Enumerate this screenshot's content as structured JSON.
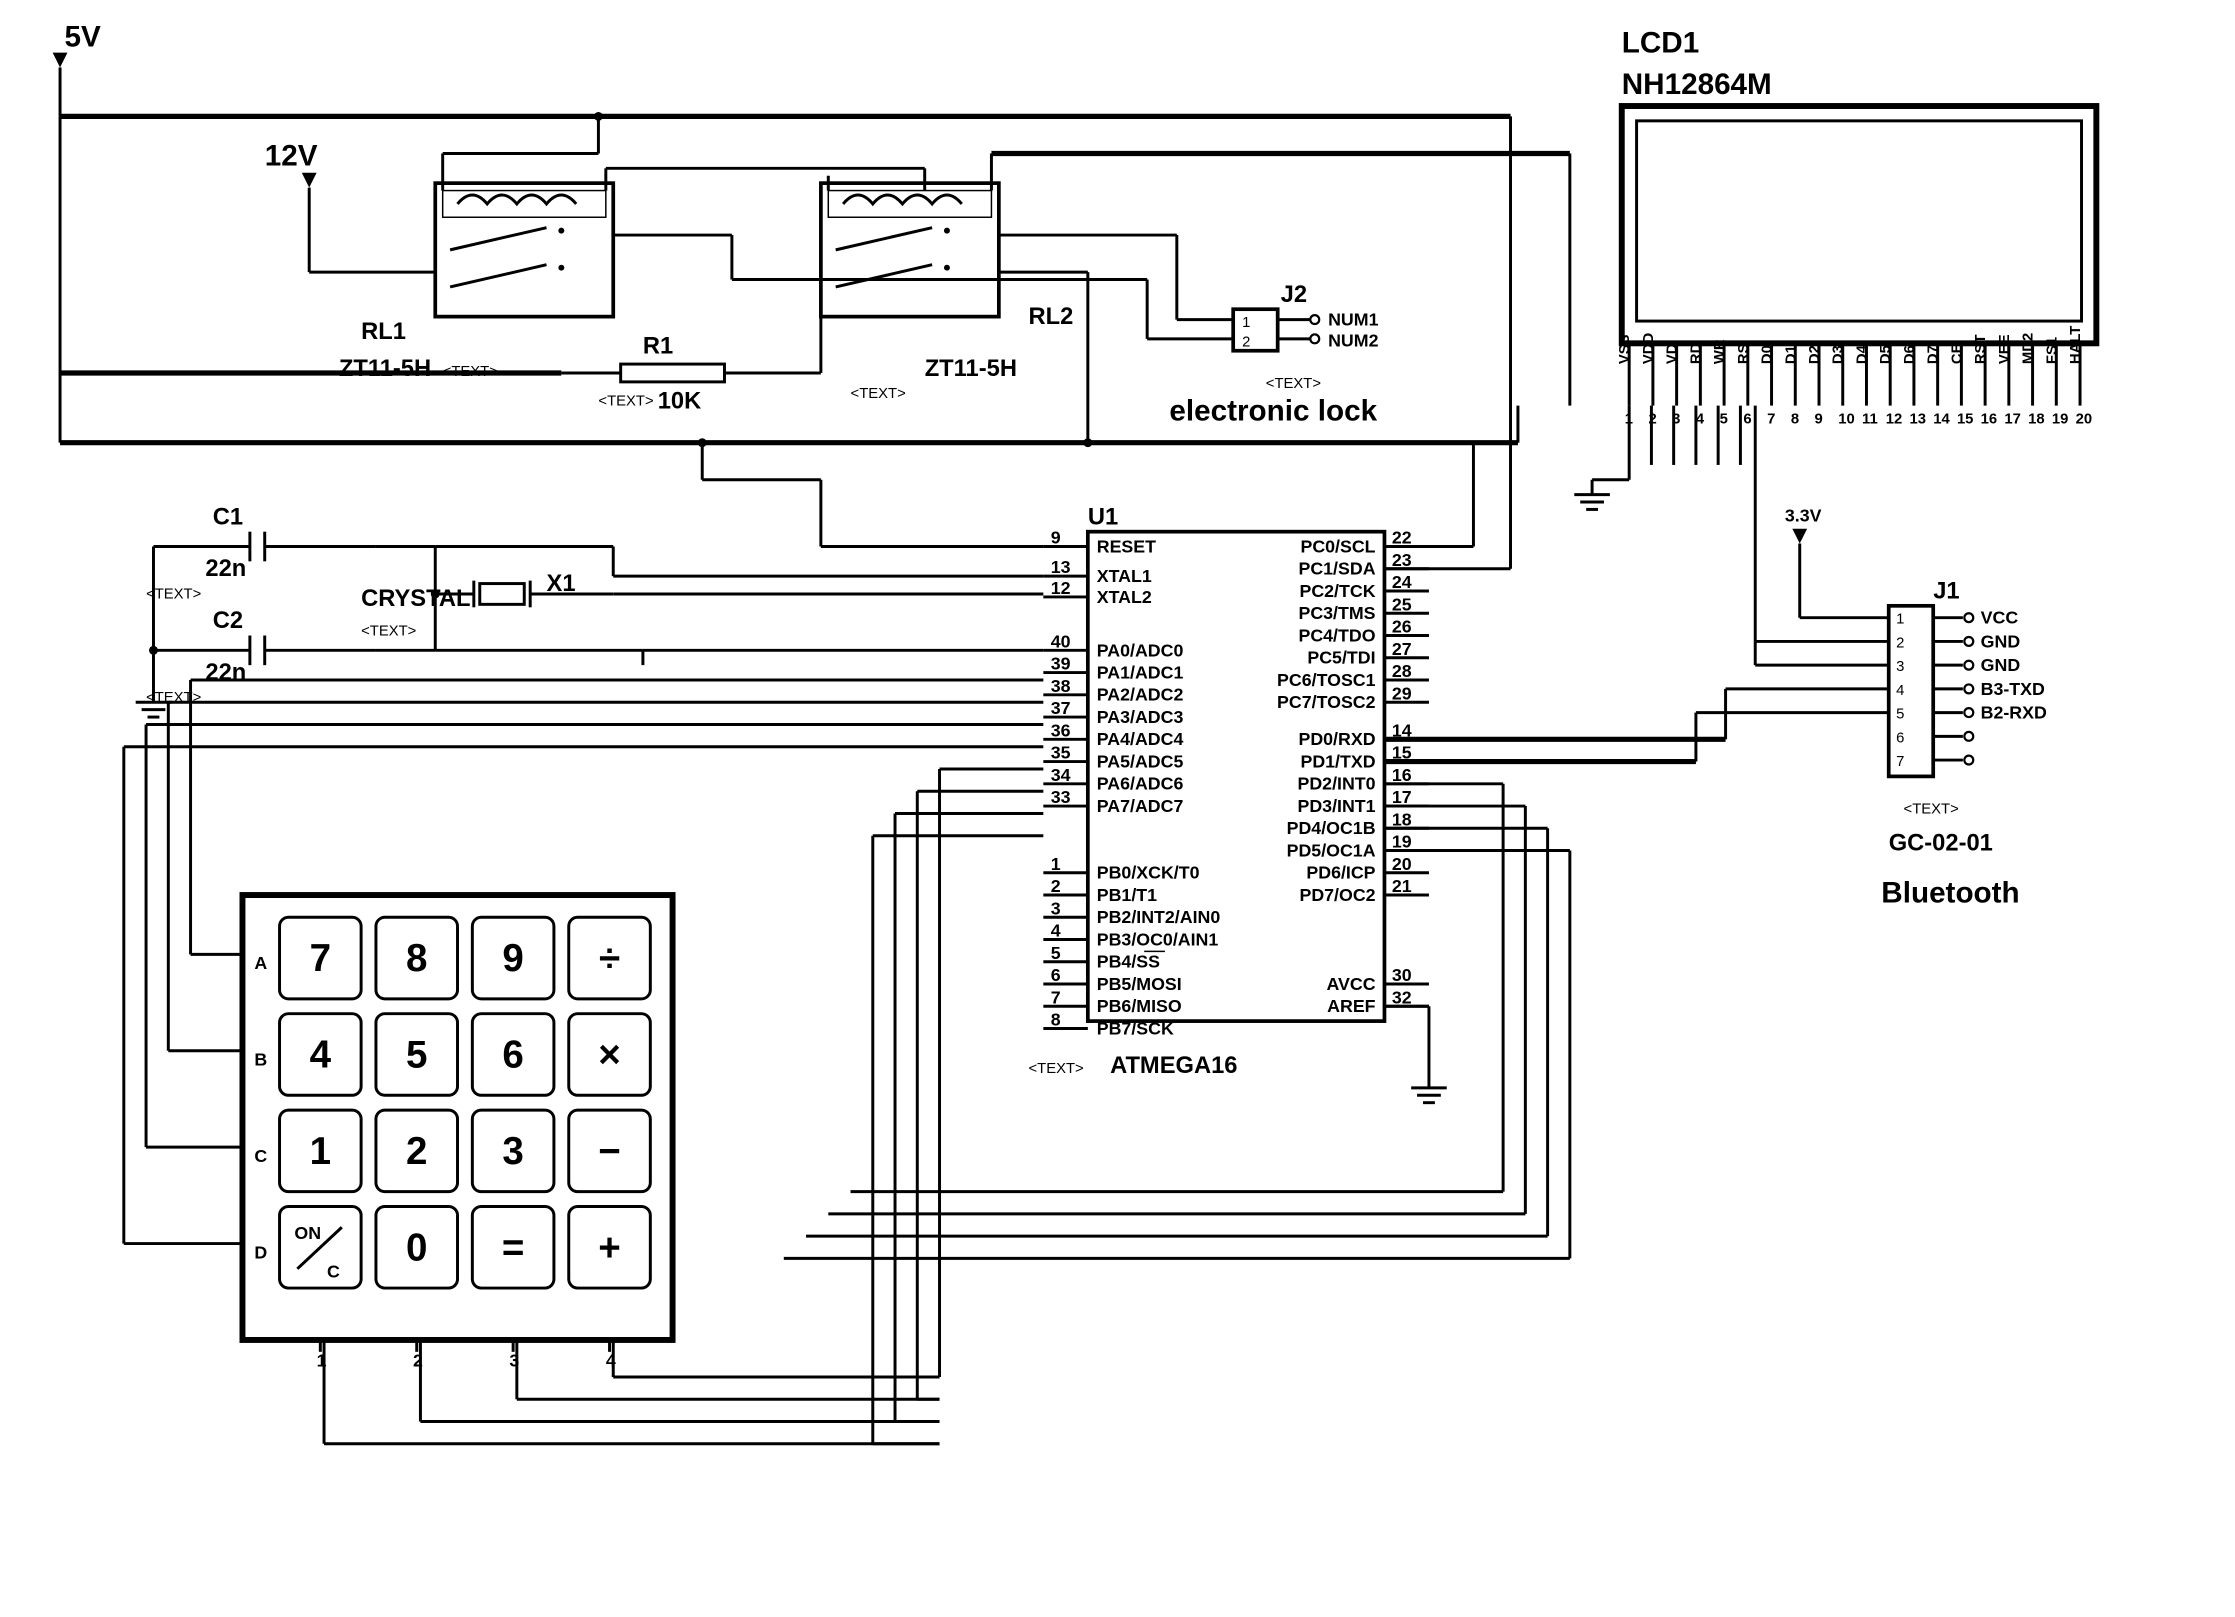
{
  "power": {
    "v5": "5V",
    "v12": "12V",
    "v33": "3.3V"
  },
  "relay1": {
    "name": "RL1",
    "model": "ZT11-5H"
  },
  "relay2": {
    "name": "RL2",
    "model": "ZT11-5H"
  },
  "resistor1": {
    "name": "R1",
    "value": "10K",
    "placeholder": "<TEXT>"
  },
  "cap1": {
    "name": "C1",
    "value": "22n",
    "placeholder": "<TEXT>"
  },
  "cap2": {
    "name": "C2",
    "value": "22n",
    "placeholder": "<TEXT>"
  },
  "crystal": {
    "name": "X1",
    "label": "CRYSTAL",
    "placeholder": "<TEXT>"
  },
  "lcd": {
    "refdes": "LCD1",
    "model": "NH12864M",
    "pins": [
      "VSS",
      "VDD",
      "VD",
      "RD",
      "WR",
      "RS",
      "D0",
      "D1",
      "D2",
      "D3",
      "D4",
      "D5",
      "D6",
      "D7",
      "CE",
      "RST",
      "VEE",
      "MD2",
      "FS1",
      "HALT"
    ]
  },
  "j2": {
    "name": "J2",
    "label": "electronic lock",
    "placeholder": "<TEXT>",
    "pin1": "NUM1",
    "pin2": "NUM2"
  },
  "j1": {
    "name": "J1",
    "model": "GC-02-01",
    "label": "Bluetooth",
    "placeholder": "<TEXT>",
    "pins": [
      "VCC",
      "GND",
      "GND",
      "B3-TXD",
      "B2-RXD",
      "",
      ""
    ]
  },
  "mcu": {
    "refdes": "U1",
    "model": "ATMEGA16",
    "placeholder": "<TEXT>",
    "left_pins": [
      {
        "n": "9",
        "l": "RESET"
      },
      {
        "n": "13",
        "l": "XTAL1"
      },
      {
        "n": "12",
        "l": "XTAL2"
      },
      {
        "n": "40",
        "l": "PA0/ADC0"
      },
      {
        "n": "39",
        "l": "PA1/ADC1"
      },
      {
        "n": "38",
        "l": "PA2/ADC2"
      },
      {
        "n": "37",
        "l": "PA3/ADC3"
      },
      {
        "n": "36",
        "l": "PA4/ADC4"
      },
      {
        "n": "35",
        "l": "PA5/ADC5"
      },
      {
        "n": "34",
        "l": "PA6/ADC6"
      },
      {
        "n": "33",
        "l": "PA7/ADC7"
      },
      {
        "n": "1",
        "l": "PB0/XCK/T0"
      },
      {
        "n": "2",
        "l": "PB1/T1"
      },
      {
        "n": "3",
        "l": "PB2/INT2/AIN0"
      },
      {
        "n": "4",
        "l": "PB3/OC0/AIN1"
      },
      {
        "n": "5",
        "l": "PB4/SS"
      },
      {
        "n": "6",
        "l": "PB5/MOSI"
      },
      {
        "n": "7",
        "l": "PB6/MISO"
      },
      {
        "n": "8",
        "l": "PB7/SCK"
      }
    ],
    "right_pins": [
      {
        "n": "22",
        "l": "PC0/SCL"
      },
      {
        "n": "23",
        "l": "PC1/SDA"
      },
      {
        "n": "24",
        "l": "PC2/TCK"
      },
      {
        "n": "25",
        "l": "PC3/TMS"
      },
      {
        "n": "26",
        "l": "PC4/TDO"
      },
      {
        "n": "27",
        "l": "PC5/TDI"
      },
      {
        "n": "28",
        "l": "PC6/TOSC1"
      },
      {
        "n": "29",
        "l": "PC7/TOSC2"
      },
      {
        "n": "14",
        "l": "PD0/RXD"
      },
      {
        "n": "15",
        "l": "PD1/TXD"
      },
      {
        "n": "16",
        "l": "PD2/INT0"
      },
      {
        "n": "17",
        "l": "PD3/INT1"
      },
      {
        "n": "18",
        "l": "PD4/OC1B"
      },
      {
        "n": "19",
        "l": "PD5/OC1A"
      },
      {
        "n": "20",
        "l": "PD6/ICP"
      },
      {
        "n": "21",
        "l": "PD7/OC2"
      },
      {
        "n": "30",
        "l": "AVCC"
      },
      {
        "n": "32",
        "l": "AREF"
      }
    ]
  },
  "keypad": {
    "rows": [
      "A",
      "B",
      "C",
      "D"
    ],
    "cols": [
      "1",
      "2",
      "3",
      "4"
    ],
    "keys": [
      [
        "7",
        "8",
        "9",
        "÷"
      ],
      [
        "4",
        "5",
        "6",
        "×"
      ],
      [
        "1",
        "2",
        "3",
        "−"
      ],
      [
        "ON/C",
        "0",
        "=",
        "+"
      ]
    ]
  }
}
